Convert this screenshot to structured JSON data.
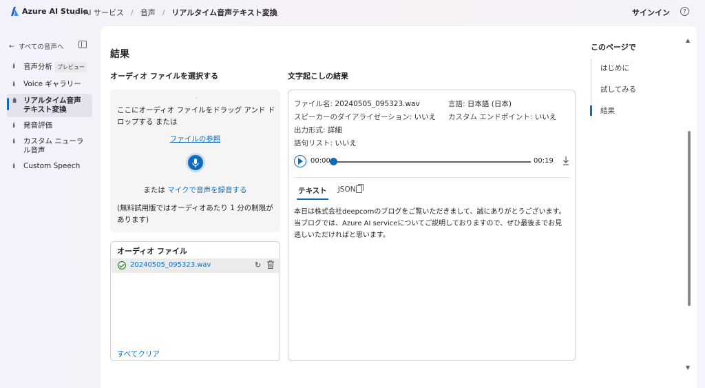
{
  "app": {
    "name": "Azure AI Studio"
  },
  "breadcrumb": {
    "items": [
      "AI サービス",
      "音声",
      "リアルタイム音声テキスト変換"
    ]
  },
  "header": {
    "signin": "サインイン",
    "help": "?"
  },
  "sidebar": {
    "back": "すべての音声へ",
    "items": [
      {
        "label": "音声分析",
        "badge": "プレビュー"
      },
      {
        "label": "Voice ギャラリー"
      },
      {
        "label": "リアルタイム音声テキスト変換"
      },
      {
        "label": "発音評価"
      },
      {
        "label": "カスタム ニューラル音声"
      },
      {
        "label": "Custom Speech"
      }
    ]
  },
  "main": {
    "title": "結果",
    "select_title": "オーディオ ファイルを選択する",
    "dropzone": {
      "dot": "·",
      "text": "ここにオーディオ ファイルをドラッグ アンド ドロップする または",
      "browse": "ファイルの参照",
      "or": "または",
      "mic_link": "マイクで音声を録音する",
      "note": "(無料試用版ではオーディオあたり 1 分の制限があります)"
    },
    "audio_files": {
      "title": "オーディオ ファイル",
      "file": "20240505_095323.wav",
      "clear": "すべてクリア"
    },
    "result": {
      "title": "文字起こしの結果",
      "filename_label": "ファイル名: ",
      "filename": "20240505_095323.wav",
      "language_label": "言語: ",
      "language": "日本語 (日本)",
      "diarization_label": "スピーカーのダイアライゼーション: ",
      "diarization": "いいえ",
      "endpoint_label": "カスタム エンドポイント: ",
      "endpoint": "いいえ",
      "format_label": "出力形式: ",
      "format": "詳細",
      "phrase_label": "語句リスト: ",
      "phrase": "いいえ",
      "time_start": "00:00",
      "time_end": "00:19",
      "tabs": [
        "テキスト",
        "JSON"
      ],
      "transcript": "本日は株式会社deepcomのブログをご覧いただきまして、誠にありがとうございます。当ブログでは、Azure AI serviceについてご説明しておりますので、ぜひ最後までお見逃しいただければと思います。"
    }
  },
  "toc": {
    "title": "このページで",
    "items": [
      "はじめに",
      "試してみる",
      "結果"
    ]
  },
  "colors": {
    "accent": "#0f6cbd",
    "success": "#107c10"
  }
}
